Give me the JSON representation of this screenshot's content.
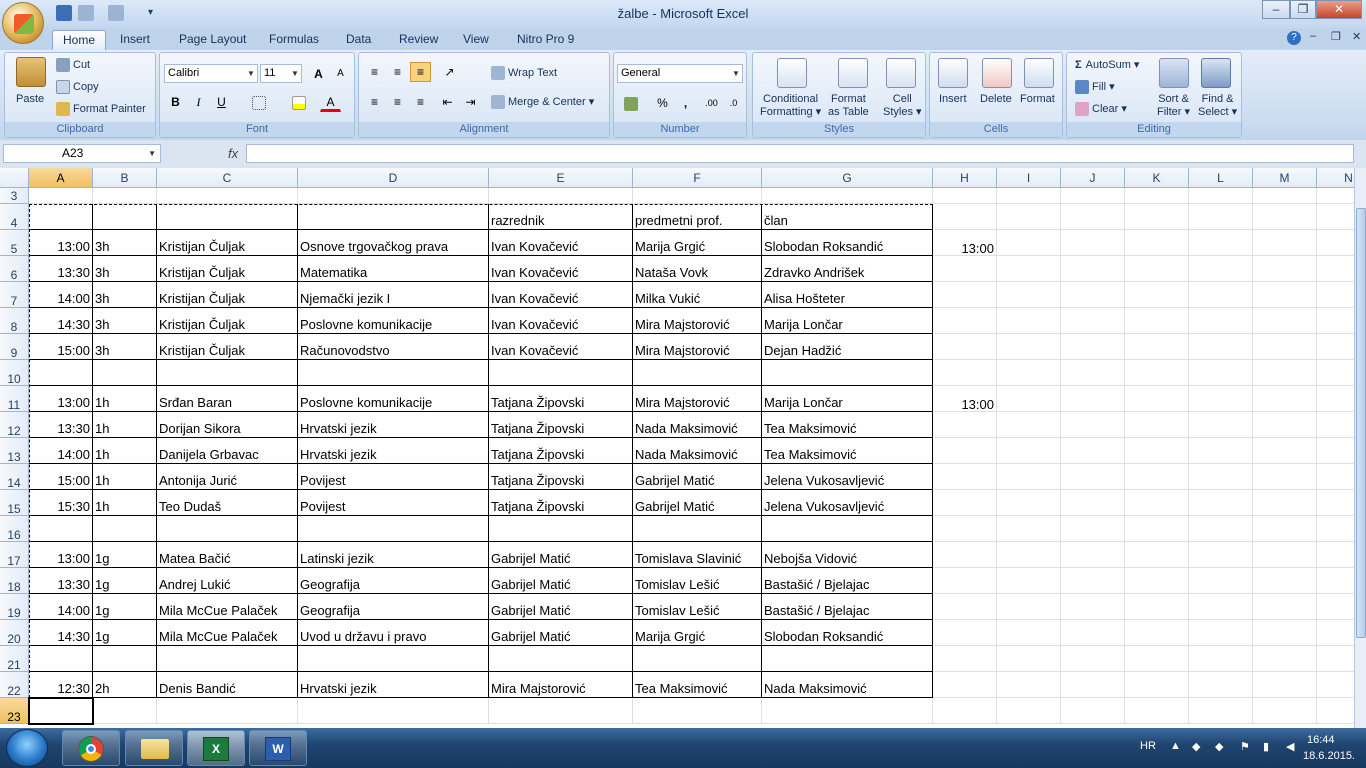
{
  "window": {
    "title": "žalbe - Microsoft Excel",
    "minimize": "‒",
    "restore": "❐",
    "close": "✕"
  },
  "tabs": [
    "Home",
    "Insert",
    "Page Layout",
    "Formulas",
    "Data",
    "Review",
    "View",
    "Nitro Pro 9"
  ],
  "ribbon": {
    "clipboard": {
      "label": "Clipboard",
      "paste": "Paste",
      "cut": "Cut",
      "copy": "Copy",
      "format_painter": "Format Painter"
    },
    "font": {
      "label": "Font",
      "name": "Calibri",
      "size": "11",
      "bold": "B",
      "italic": "I",
      "underline": "U",
      "grow": "A",
      "shrink": "A",
      "font_color": "A"
    },
    "alignment": {
      "label": "Alignment",
      "wrap_text": "Wrap Text",
      "merge_center": "Merge & Center"
    },
    "number": {
      "label": "Number",
      "format": "General",
      "percent": "%",
      "comma": ",",
      "inc_decimal": ".00",
      "dec_decimal": ".0"
    },
    "styles": {
      "label": "Styles",
      "conditional": "Conditional",
      "conditional2": "Formatting",
      "format_table": "Format",
      "format_table2": "as Table",
      "cell_styles": "Cell",
      "cell_styles2": "Styles"
    },
    "cells": {
      "label": "Cells",
      "insert": "Insert",
      "delete": "Delete",
      "format": "Format"
    },
    "editing": {
      "label": "Editing",
      "autosum": "AutoSum",
      "fill": "Fill",
      "clear": "Clear",
      "sort": "Sort &",
      "sort2": "Filter",
      "find": "Find &",
      "find2": "Select"
    }
  },
  "formula_bar": {
    "name_box": "A23",
    "fx": "fx",
    "formula": ""
  },
  "columns": [
    "A",
    "B",
    "C",
    "D",
    "E",
    "F",
    "G",
    "H",
    "I",
    "J",
    "K",
    "L",
    "M",
    "N"
  ],
  "selected_column": "A",
  "rows": [
    {
      "num": "3",
      "cells": [
        "",
        "",
        "",
        "",
        "",
        "",
        "",
        ""
      ]
    },
    {
      "num": "4",
      "cells": [
        "",
        "",
        "",
        "",
        "razrednik",
        "predmetni prof.",
        "član",
        ""
      ]
    },
    {
      "num": "5",
      "cells": [
        "13:00",
        "3h",
        "Kristijan Čuljak",
        "Osnove trgovačkog prava",
        "Ivan Kovačević",
        "Marija Grgić",
        "Slobodan Roksandić",
        "13:00"
      ]
    },
    {
      "num": "6",
      "cells": [
        "13:30",
        "3h",
        "Kristijan Čuljak",
        "Matematika",
        "Ivan Kovačević",
        "Nataša Vovk",
        "Zdravko Andrišek",
        ""
      ]
    },
    {
      "num": "7",
      "cells": [
        "14:00",
        "3h",
        "Kristijan Čuljak",
        "Njemački jezik I",
        "Ivan Kovačević",
        "Milka Vukić",
        "Alisa Hošteter",
        ""
      ]
    },
    {
      "num": "8",
      "cells": [
        "14:30",
        "3h",
        "Kristijan Čuljak",
        "Poslovne komunikacije",
        "Ivan Kovačević",
        "Mira Majstorović",
        "Marija Lončar",
        ""
      ]
    },
    {
      "num": "9",
      "cells": [
        "15:00",
        "3h",
        "Kristijan Čuljak",
        "Računovodstvo",
        "Ivan Kovačević",
        "Mira Majstorović",
        "Dejan Hadžić",
        ""
      ]
    },
    {
      "num": "10",
      "cells": [
        "",
        "",
        "",
        "",
        "",
        "",
        "",
        ""
      ]
    },
    {
      "num": "11",
      "cells": [
        "13:00",
        "1h",
        "Srđan Baran",
        "Poslovne komunikacije",
        "Tatjana Žipovski",
        "Mira Majstorović",
        "Marija Lončar",
        "13:00"
      ]
    },
    {
      "num": "12",
      "cells": [
        "13:30",
        "1h",
        "Dorijan Sikora",
        "Hrvatski jezik",
        "Tatjana Žipovski",
        "Nada Maksimović",
        "Tea Maksimović",
        ""
      ]
    },
    {
      "num": "13",
      "cells": [
        "14:00",
        "1h",
        "Danijela Grbavac",
        "Hrvatski jezik",
        "Tatjana Žipovski",
        "Nada Maksimović",
        "Tea Maksimović",
        ""
      ]
    },
    {
      "num": "14",
      "cells": [
        "15:00",
        "1h",
        "Antonija Jurić",
        "Povijest",
        "Tatjana Žipovski",
        "Gabrijel Matić",
        "Jelena Vukosavljević",
        ""
      ]
    },
    {
      "num": "15",
      "cells": [
        "15:30",
        "1h",
        "Teo Dudaš",
        "Povijest",
        "Tatjana Žipovski",
        "Gabrijel Matić",
        "Jelena Vukosavljević",
        ""
      ]
    },
    {
      "num": "16",
      "cells": [
        "",
        "",
        "",
        "",
        "",
        "",
        "",
        ""
      ]
    },
    {
      "num": "17",
      "cells": [
        "13:00",
        "1g",
        "Matea Bačić",
        "Latinski jezik",
        "Gabrijel Matić",
        "Tomislava Slavinić",
        "Nebojša Vidović",
        ""
      ]
    },
    {
      "num": "18",
      "cells": [
        "13:30",
        "1g",
        "Andrej Lukić",
        "Geografija",
        "Gabrijel Matić",
        "Tomislav Lešić",
        "Bastašić / Bjelajac",
        ""
      ]
    },
    {
      "num": "19",
      "cells": [
        "14:00",
        "1g",
        "Mila McCue Palaček",
        "Geografija",
        "Gabrijel Matić",
        "Tomislav Lešić",
        "Bastašić / Bjelajac",
        ""
      ]
    },
    {
      "num": "20",
      "cells": [
        "14:30",
        "1g",
        "Mila McCue Palaček",
        "Uvod u državu i pravo",
        "Gabrijel Matić",
        "Marija Grgić",
        "Slobodan Roksandić",
        ""
      ]
    },
    {
      "num": "21",
      "cells": [
        "",
        "",
        "",
        "",
        "",
        "",
        "",
        ""
      ]
    },
    {
      "num": "22",
      "cells": [
        "12:30",
        "2h",
        "Denis Bandić",
        "Hrvatski jezik",
        "Mira Majstorović",
        "Tea Maksimović",
        "Nada Maksimović",
        ""
      ]
    },
    {
      "num": "23",
      "cells": [
        "",
        "",
        "",
        "",
        "",
        "",
        "",
        ""
      ]
    }
  ],
  "taskbar": {
    "lang": "HR",
    "time": "16:44",
    "date": "18.6.2015."
  }
}
